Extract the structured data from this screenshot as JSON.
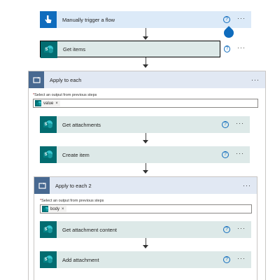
{
  "trigger": {
    "title": "Manually trigger a flow"
  },
  "get_items": {
    "title": "Get items"
  },
  "apply_each": {
    "title": "Apply to each",
    "field_label": "Select an output from previous steps",
    "token": "value",
    "get_attachments": "Get attachments",
    "create_item": "Create item"
  },
  "apply_each_2": {
    "title": "Apply to each 2",
    "field_label": "Select an output from previous steps",
    "token": "body",
    "get_content": "Get attachment content",
    "add_attachment": "Add attachment"
  },
  "common": {
    "help": "?",
    "more": "···",
    "required": "*",
    "remove": "×"
  },
  "colors": {
    "trigger": "#0f6cbd",
    "sharepoint": "#036c70",
    "scope": "#486991"
  }
}
